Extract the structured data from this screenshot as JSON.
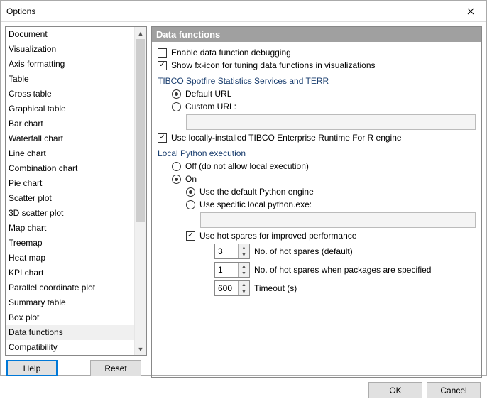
{
  "window": {
    "title": "Options"
  },
  "sidebar": {
    "items": [
      "Document",
      "Visualization",
      "Axis formatting",
      "Table",
      "Cross table",
      "Graphical table",
      "Bar chart",
      "Waterfall chart",
      "Line chart",
      "Combination chart",
      "Pie chart",
      "Scatter plot",
      "3D scatter plot",
      "Map chart",
      "Treemap",
      "Heat map",
      "KPI chart",
      "Parallel coordinate plot",
      "Summary table",
      "Box plot",
      "Data functions",
      "Compatibility"
    ],
    "selected_index": 20,
    "help_label": "Help",
    "reset_label": "Reset"
  },
  "header": "Data functions",
  "options": {
    "enable_debug": {
      "label": "Enable data function debugging",
      "checked": false
    },
    "show_fx": {
      "label": "Show fx-icon for tuning data functions in visualizations",
      "checked": true
    },
    "terr_group": "TIBCO Spotfire Statistics Services and TERR",
    "url_mode": {
      "default_label": "Default URL",
      "custom_label": "Custom URL:",
      "value": "default"
    },
    "use_local_terr": {
      "label": "Use locally-installed TIBCO Enterprise Runtime For R engine",
      "checked": true
    },
    "python_group": "Local Python execution",
    "python_mode": {
      "off_label": "Off (do not allow local execution)",
      "on_label": "On",
      "value": "on"
    },
    "python_engine": {
      "default_label": "Use the default Python engine",
      "specific_label": "Use specific local python.exe:",
      "value": "default"
    },
    "hot_spares": {
      "label": "Use hot spares for improved performance",
      "checked": true
    },
    "spares_default": {
      "value": "3",
      "label": "No. of hot spares (default)"
    },
    "spares_pkg": {
      "value": "1",
      "label": "No. of hot spares when packages are specified"
    },
    "timeout": {
      "value": "600",
      "label": "Timeout (s)"
    }
  },
  "footer": {
    "ok": "OK",
    "cancel": "Cancel"
  }
}
